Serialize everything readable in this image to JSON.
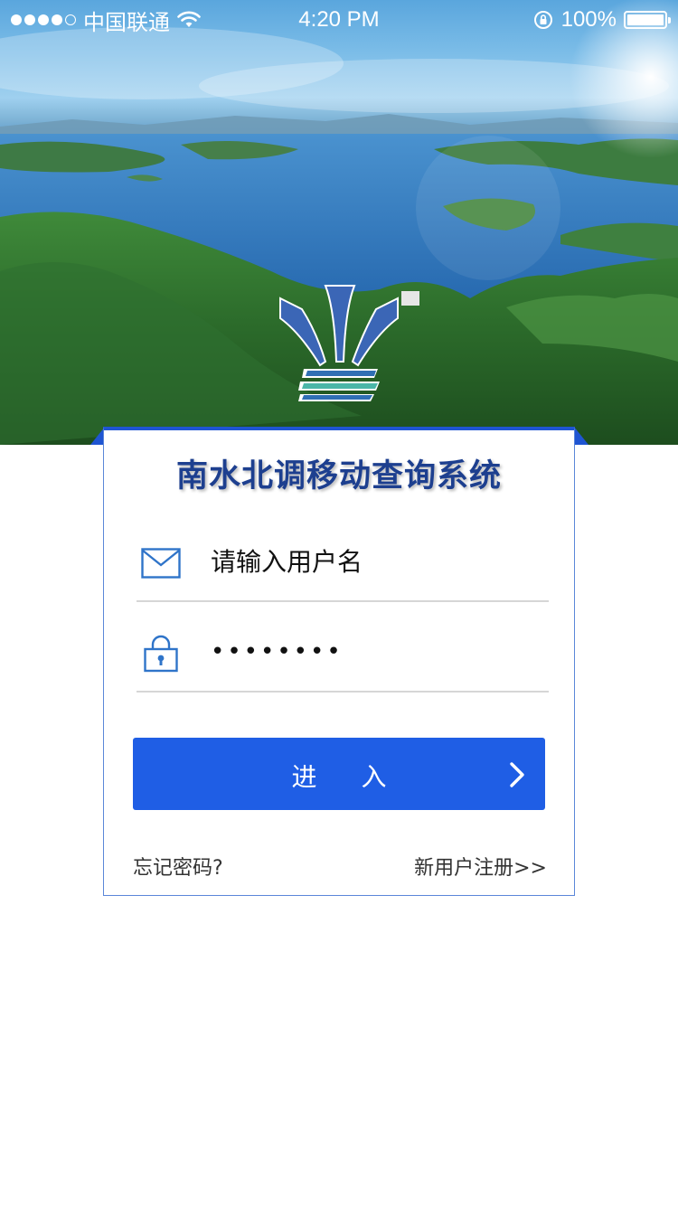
{
  "status_bar": {
    "carrier": "中国联通",
    "time": "4:20 PM",
    "battery": "100%",
    "signal_dots_filled": 4,
    "signal_dots_total": 5
  },
  "app": {
    "title": "南水北调移动查询系统"
  },
  "login": {
    "username_placeholder": "请输入用户名",
    "password_value": "••••••••",
    "submit_label": "进 入",
    "forgot_password": "忘记密码?",
    "register": "新用户注册>>"
  },
  "icons": {
    "username": "mail-icon",
    "password": "lock-icon",
    "submit_arrow": "chevron-right-icon",
    "wifi": "wifi-icon",
    "rotation_lock": "rotation-lock-icon",
    "battery": "battery-icon"
  },
  "colors": {
    "primary": "#1f5ee5",
    "title": "#1d3f8f",
    "card_border": "#5b87d9"
  }
}
